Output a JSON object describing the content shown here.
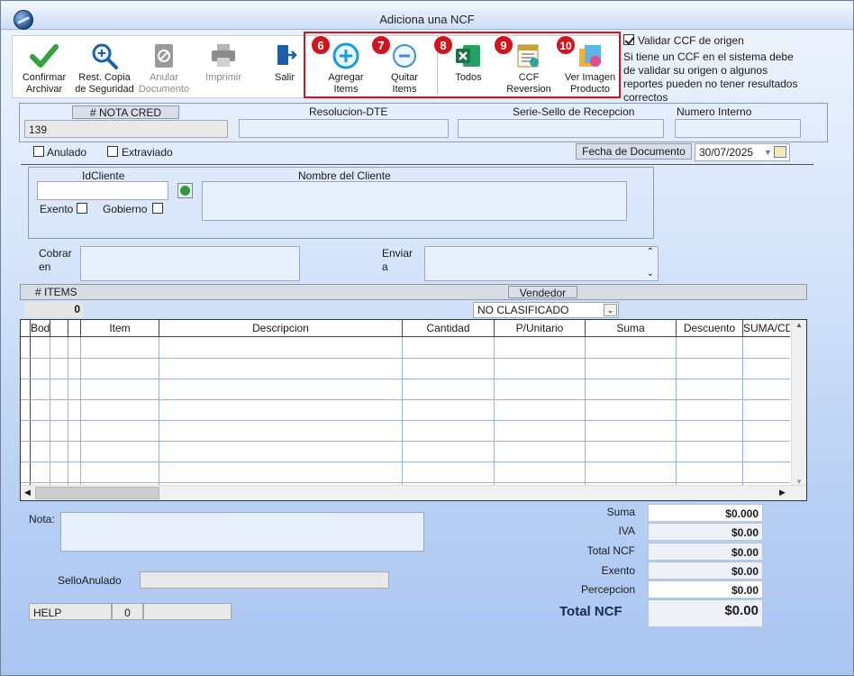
{
  "window": {
    "title": "Adiciona una NCF"
  },
  "toolbar": {
    "confirm": {
      "line1": "Confirmar",
      "line2": "Archivar"
    },
    "restore": {
      "line1": "Rest. Copia",
      "line2": "de Seguridad"
    },
    "cancel_doc": {
      "line1": "Anular",
      "line2": "Documento"
    },
    "print": {
      "line1": "Imprimir"
    },
    "exit": {
      "line1": "Salir"
    },
    "add_items": {
      "line1": "Agregar",
      "line2": "Items",
      "badge": "6"
    },
    "remove_items": {
      "line1": "Quitar",
      "line2": "Items",
      "badge": "7"
    },
    "all": {
      "line1": "Todos",
      "badge": "8"
    },
    "ccf_reversion": {
      "line1": "CCF",
      "line2": "Reversion",
      "badge": "9"
    },
    "view_image": {
      "line1": "Ver Imagen",
      "line2": "Producto",
      "badge": "10"
    }
  },
  "validate": {
    "label": "Validar CCF de origen",
    "note": [
      "Si tiene un CCF en el sistema debe",
      "de validar su origen o algunos",
      "reportes pueden no tener resultados",
      "correctos"
    ]
  },
  "doc": {
    "nota_cred_label": "# NOTA CRED",
    "nota_cred_value": "139",
    "resolucion_label": "Resolucion-DTE",
    "serie_label": "Serie-Sello de Recepcion",
    "numero_label": "Numero Interno",
    "anulado_label": "Anulado",
    "extraviado_label": "Extraviado",
    "fecha_label": "Fecha de  Documento",
    "fecha_value": "30/07/2025"
  },
  "cliente": {
    "id_label": "IdCliente",
    "nombre_label": "Nombre del Cliente",
    "exento_label": "Exento",
    "gobierno_label": "Gobierno"
  },
  "cobrar": {
    "line1": "Cobrar",
    "line2": "en"
  },
  "enviar": {
    "line1": "Enviar",
    "line2": "a"
  },
  "items": {
    "count_label": "# ITEMS",
    "count_value": "0",
    "vendedor_label": "Vendedor",
    "vendedor_value": "NO CLASIFICADO"
  },
  "grid": {
    "columns": [
      "Bodega",
      "",
      "",
      "Item",
      "Descripcion",
      "Cantidad",
      "P/Unitario",
      "Suma",
      "Descuento",
      "SUMA/CD"
    ]
  },
  "nota_label": "Nota:",
  "sello_label": "SelloAnulado",
  "status": {
    "help": "HELP",
    "count": "0"
  },
  "totals": {
    "suma": {
      "label": "Suma",
      "value": "$0.000"
    },
    "iva": {
      "label": "IVA",
      "value": "$0.00"
    },
    "total_ncf": {
      "label": "Total NCF",
      "value": "$0.00"
    },
    "exento": {
      "label": "Exento",
      "value": "$0.00"
    },
    "percepcion": {
      "label": "Percepcion",
      "value": "$0.00"
    },
    "grand": {
      "label": "Total NCF",
      "value": "$0.00"
    }
  },
  "colors": {
    "badge": "#d3141c",
    "highlight_border": "#d3141c",
    "excel": "#1e7145",
    "add": "#1a9be0"
  }
}
